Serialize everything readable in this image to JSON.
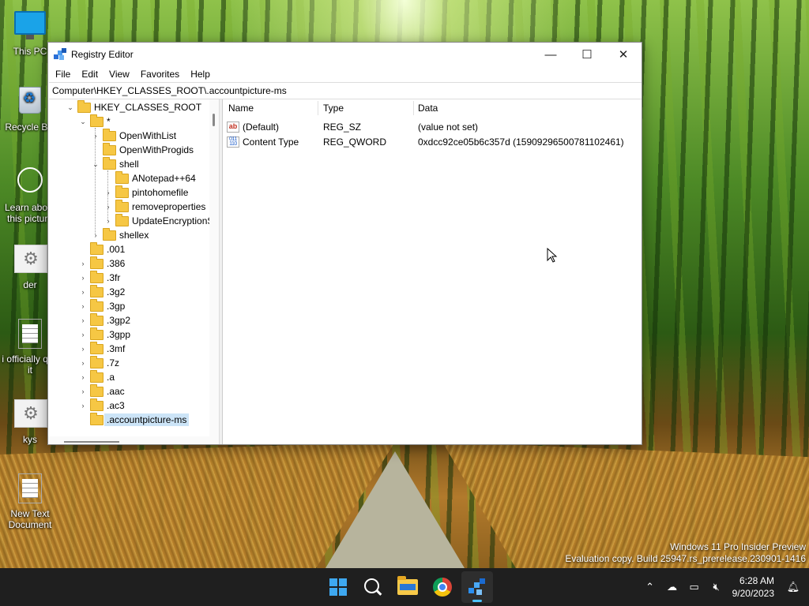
{
  "desktop": {
    "icons": [
      {
        "label": "This PC"
      },
      {
        "label": "Recycle Bin"
      },
      {
        "label": "Learn about this picture"
      },
      {
        "label": "der"
      },
      {
        "label": "i officially quit it"
      },
      {
        "label": "kys"
      },
      {
        "label": "New Text Document"
      }
    ],
    "watermark_line1": "Windows 11 Pro Insider Preview",
    "watermark_line2": "Evaluation copy. Build 25947.rs_prerelease.230901-1416"
  },
  "window": {
    "title": "Registry Editor",
    "controls": {
      "minimize": "—",
      "maximize": "☐",
      "close": "✕"
    },
    "menu": [
      "File",
      "Edit",
      "View",
      "Favorites",
      "Help"
    ],
    "address": "Computer\\HKEY_CLASSES_ROOT\\.accountpicture-ms",
    "tree": [
      {
        "label": "HKEY_CLASSES_ROOT",
        "expanded": true
      },
      {
        "label": "*",
        "expanded": true
      },
      {
        "label": "OpenWithList"
      },
      {
        "label": "OpenWithProgids"
      },
      {
        "label": "shell",
        "expanded": true
      },
      {
        "label": "ANotepad++64"
      },
      {
        "label": "pintohomefile"
      },
      {
        "label": "removeproperties"
      },
      {
        "label": "UpdateEncryptionSettings"
      },
      {
        "label": "shellex"
      },
      {
        "label": ".001"
      },
      {
        "label": ".386"
      },
      {
        "label": ".3fr"
      },
      {
        "label": ".3g2"
      },
      {
        "label": ".3gp"
      },
      {
        "label": ".3gp2"
      },
      {
        "label": ".3gpp"
      },
      {
        "label": ".3mf"
      },
      {
        "label": ".7z"
      },
      {
        "label": ".a"
      },
      {
        "label": ".aac"
      },
      {
        "label": ".ac3"
      },
      {
        "label": ".accountpicture-ms",
        "selected": true
      }
    ],
    "columns": {
      "name": "Name",
      "type": "Type",
      "data": "Data"
    },
    "values": [
      {
        "icon": "ab",
        "name": "(Default)",
        "type": "REG_SZ",
        "data": "(value not set)"
      },
      {
        "icon": "binary",
        "name": "Content Type",
        "type": "REG_QWORD",
        "data": "0xdcc92ce05b6c357d (15909296500781102461)"
      }
    ]
  },
  "taskbar": {
    "time": "6:28 AM",
    "date": "9/20/2023",
    "active_app": "Registry Editor",
    "accent": "#4cc2ff"
  }
}
